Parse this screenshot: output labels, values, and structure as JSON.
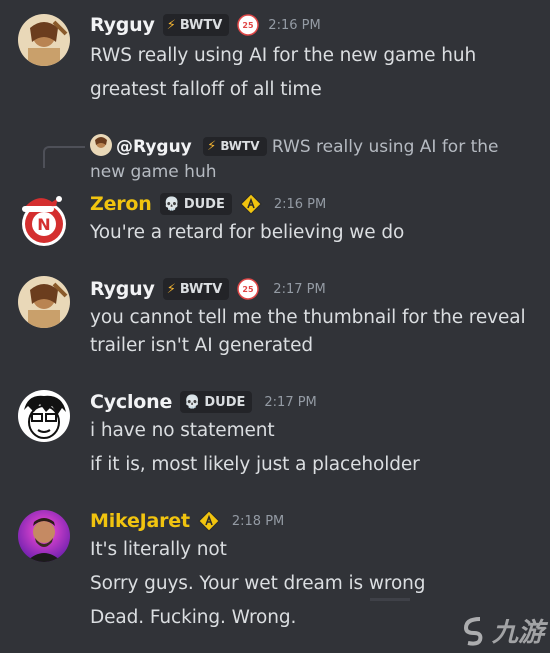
{
  "messages": [
    {
      "username": "Ryguy",
      "tag": "BWTV",
      "timestamp": "2:16 PM",
      "lines": [
        "RWS really using AI for the new game huh",
        "greatest falloff of all time"
      ]
    },
    {
      "reply": {
        "mention": "@Ryguy",
        "tag": "BWTV",
        "text": "RWS really using AI for the new game huh"
      },
      "username": "Zeron",
      "tag": "DUDE",
      "timestamp": "2:16 PM",
      "lines": [
        "You're a retard for believing we do"
      ],
      "name_color": "#f1c40f"
    },
    {
      "username": "Ryguy",
      "tag": "BWTV",
      "timestamp": "2:17 PM",
      "lines": [
        "you cannot tell me the thumbnail for the reveal",
        "trailer isn't AI generated"
      ]
    },
    {
      "username": "Cyclone",
      "tag": "DUDE",
      "timestamp": "2:17 PM",
      "lines": [
        "i have no statement",
        "if it is, most likely just a placeholder"
      ]
    },
    {
      "username": "MikeJaret",
      "timestamp": "2:18 PM",
      "lines": [
        "It's literally not",
        "Sorry guys. Your wet dream is wrong",
        "Dead. Fucking. Wrong."
      ],
      "name_color": "#f1c40f"
    }
  ],
  "badge_text": "25",
  "watermark": "九游",
  "colors": {
    "background": "#313338",
    "text": "#dbdee1",
    "muted": "#949ba4",
    "gold": "#f1c40f"
  }
}
